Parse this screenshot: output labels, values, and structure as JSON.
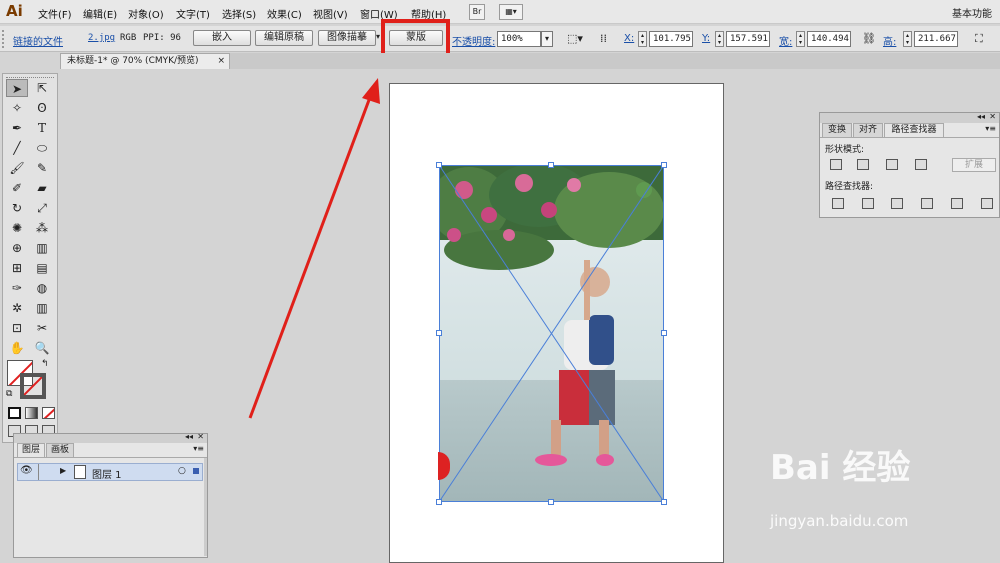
{
  "app": {
    "logo": "Ai",
    "workspace": "基本功能"
  },
  "menu": [
    "文件(F)",
    "编辑(E)",
    "对象(O)",
    "文字(T)",
    "选择(S)",
    "效果(C)",
    "视图(V)",
    "窗口(W)",
    "帮助(H)"
  ],
  "menu_badge": "Br",
  "control": {
    "linked_file": "链接的文件",
    "file_name": "2.jpg",
    "mode": "RGB",
    "ppi": "PPI: 96",
    "embed": "嵌入",
    "edit_original": "编辑原稿",
    "image_trace": "图像描摹",
    "mask": "蒙版",
    "opacity_label": "不透明度:",
    "opacity_value": "100%",
    "x_label": "X:",
    "x_value": "101.795",
    "y_label": "Y:",
    "y_value": "157.591",
    "w_label": "宽:",
    "w_value": "140.494",
    "h_label": "高:",
    "h_value": "211.667"
  },
  "document": {
    "tab_title": "未标题-1* @ 70% (CMYK/预览)",
    "close": "×"
  },
  "pathfinder": {
    "tabs": [
      "变换",
      "对齐",
      "路径查找器"
    ],
    "shape_modes_label": "形状模式:",
    "expand": "扩展",
    "pathfinders_label": "路径查找器:"
  },
  "layers": {
    "tabs": [
      "图层",
      "画板"
    ],
    "layer_name": "图层 1"
  },
  "watermark": {
    "brand": "Bai 经验",
    "url": "jingyan.baidu.com"
  },
  "colors": {
    "highlight": "#e0201a",
    "arrow": "#e0201a",
    "link": "#1a4fa8"
  }
}
